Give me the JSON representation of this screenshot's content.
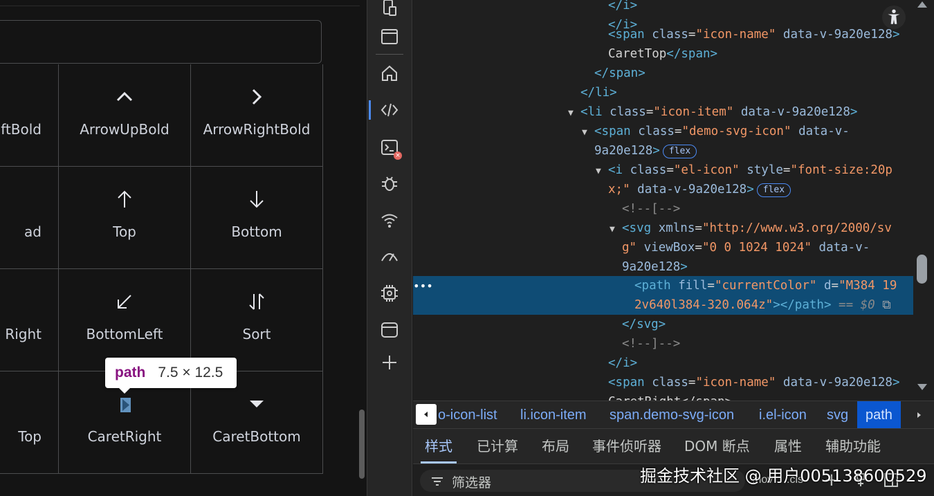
{
  "icon_grid": {
    "cells": [
      {
        "label": "ftBold",
        "icon": "arrow-left-bold-icon"
      },
      {
        "label": "ArrowUpBold",
        "icon": "arrow-up-bold-icon"
      },
      {
        "label": "ArrowRightBold",
        "icon": "arrow-right-bold-icon"
      },
      {
        "label": "ad",
        "icon": "partial-icon"
      },
      {
        "label": "Top",
        "icon": "top-arrow-icon"
      },
      {
        "label": "Bottom",
        "icon": "bottom-arrow-icon"
      },
      {
        "label": "Right",
        "icon": "partial-icon"
      },
      {
        "label": "BottomLeft",
        "icon": "bottom-left-arrow-icon"
      },
      {
        "label": "Sort",
        "icon": "sort-icon"
      },
      {
        "label": "Top",
        "icon": "partial-icon"
      },
      {
        "label": "CaretRight",
        "icon": "caret-right-icon"
      },
      {
        "label": "CaretBottom",
        "icon": "caret-bottom-icon"
      }
    ]
  },
  "tooltip": {
    "tag": "path",
    "dimensions": "7.5 × 12.5"
  },
  "dom": {
    "l0_close_i": "</i>",
    "l1_span_open": "<span",
    "l1_attr": "class",
    "l1_val": "\"icon-name\"",
    "l1_attr2": "data-v-9a20e128",
    "l1_close": ">",
    "l2_text": "CaretTop",
    "l2_close": "</span>",
    "l3_close_span": "</span>",
    "l4_close_li": "</li>",
    "l5_open": "<li",
    "l5_val": "\"icon-item\"",
    "l6_open": "<span",
    "l6_val": "\"demo-svg-icon\"",
    "l6_attr2": "data-v-",
    "l7_text": "9a20e128",
    "flex": "flex",
    "l8_open": "<i",
    "l8_val": "\"el-icon\"",
    "l8_attr": "style",
    "l8_style": "\"font-size:20p",
    "l9_style": "x;\"",
    "comment_open": "<!--[-->",
    "l11_open": "<svg",
    "l11_attr": "xmlns",
    "l11_val": "\"http://www.w3.org/2000/sv",
    "l12_val": "g\"",
    "l12_attr": "viewBox",
    "l12_val2": "\"0 0 1024 1024\"",
    "l14_open": "<path",
    "l14_attr": "fill",
    "l14_val": "\"currentColor\"",
    "l14_attr2": "d",
    "l14_val2": "\"M384 19",
    "l15_val": "2v640l384-320.064z\"",
    "l15_close": "></path>",
    "l15_eq": "== $0",
    "l16_close": "</svg>",
    "comment_close": "<!--]-->",
    "l18_close": "</i>",
    "l20_text": "CaretRight</span>"
  },
  "breadcrumb": {
    "items": [
      {
        "label": "o-icon-list"
      },
      {
        "label": "li.icon-item"
      },
      {
        "label": "span.demo-svg-icon"
      },
      {
        "label": "i.el-icon"
      },
      {
        "label": "svg"
      },
      {
        "label": "path"
      }
    ]
  },
  "panel_tabs": [
    {
      "label": "样式"
    },
    {
      "label": "已计算"
    },
    {
      "label": "布局"
    },
    {
      "label": "事件侦听器"
    },
    {
      "label": "DOM 断点"
    },
    {
      "label": "属性"
    },
    {
      "label": "辅助功能"
    }
  ],
  "filter": {
    "label": "筛选器",
    "hov": ":hov",
    "cls": ".cls",
    "add": "+"
  },
  "watermark": "掘金技术社区 @ 用户005138600529",
  "colors": {
    "accent": "#4c8bf5",
    "selected_row": "#0f4c75",
    "tag": "#5db0d7",
    "value": "#f29766"
  }
}
